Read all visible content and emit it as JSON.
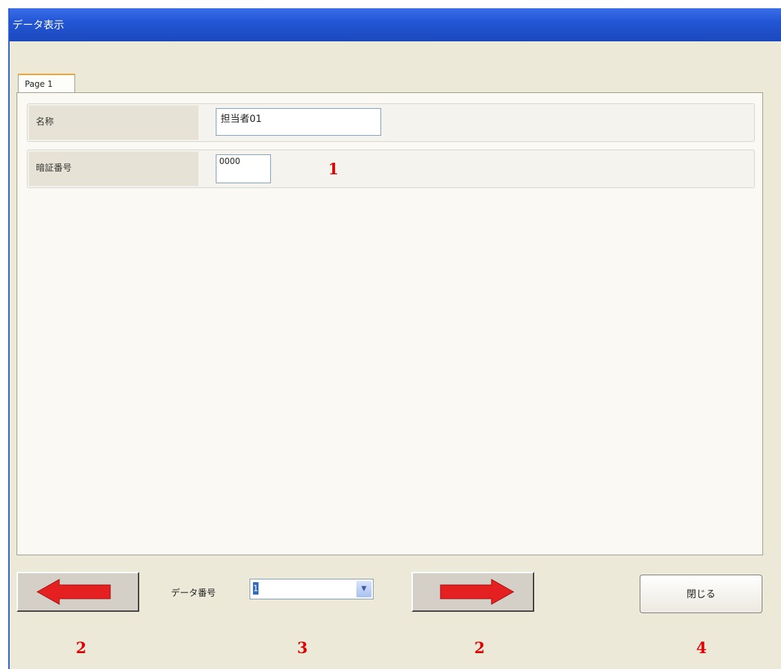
{
  "window": {
    "title": "データ表示"
  },
  "tabs": [
    {
      "label": "Page 1"
    }
  ],
  "fields": {
    "name": {
      "label": "名称",
      "value": "担当者01"
    },
    "pin": {
      "label": "暗証番号",
      "value": "0000"
    }
  },
  "footer": {
    "data_number_label": "データ番号",
    "data_number_value": "1",
    "close_label": "閉じる",
    "prev_icon": "left-arrow-icon",
    "next_icon": "right-arrow-icon",
    "arrow_color": "#e52020"
  },
  "annotations": [
    "1",
    "2",
    "3",
    "2",
    "4"
  ]
}
